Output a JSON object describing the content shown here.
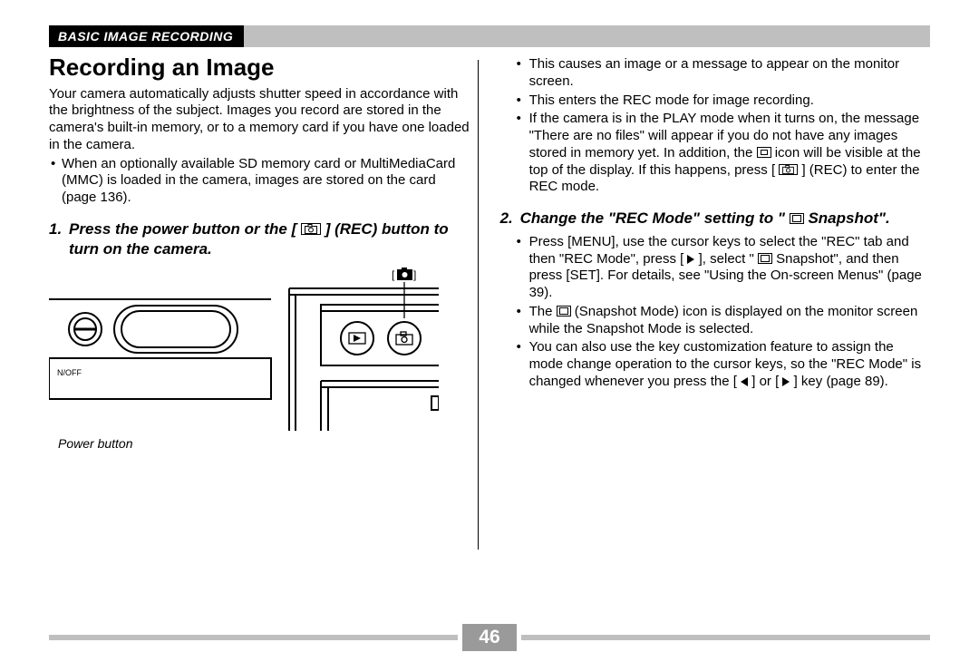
{
  "header": {
    "section": "BASIC IMAGE RECORDING"
  },
  "left": {
    "title": "Recording an Image",
    "intro": "Your camera automatically adjusts shutter speed in accordance with the brightness of the subject. Images you record are stored in the camera's built-in memory, or to a memory card if you have one loaded in the camera.",
    "bullet1": "When an optionally available SD memory card or MultiMediaCard (MMC) is loaded in the camera, images are stored on the card (page 136).",
    "step1_num": "1.",
    "step1_a": "Press the power button or the [",
    "step1_b": "] (REC) button to turn on the camera.",
    "diagram_caption": "Power button",
    "diagram_label_onoff": "N/OFF",
    "diagram_label_rec_bracket_l": "[",
    "diagram_label_rec_bracket_r": "]"
  },
  "right": {
    "b1": "This causes an image or a message to appear on the monitor screen.",
    "b2": "This enters the REC mode for image recording.",
    "b3_a": "If the camera is in the PLAY mode when it turns on, the message \"There are no files\" will appear if you do not have any images stored in memory yet. In addition, the ",
    "b3_b": " icon will be visible at the top of the display. If this happens, press [",
    "b3_c": "] (REC) to enter the REC mode.",
    "step2_num": "2.",
    "step2_a": "Change the \"REC Mode\" setting to \"",
    "step2_b": " Snapshot\".",
    "b4_a": "Press [MENU], use the cursor keys to select the \"REC\" tab and then \"REC Mode\", press [",
    "b4_b": "], select \"",
    "b4_c": " Snapshot\", and then press [SET]. For details, see \"Using the On-screen Menus\" (page 39).",
    "b5_a": "The ",
    "b5_b": " (Snapshot Mode) icon is displayed on the monitor screen while the Snapshot Mode is selected.",
    "b6_a": "You can also use the key customization feature to assign the mode change operation to the cursor keys, so the \"REC Mode\" is changed whenever you press the [",
    "b6_b": "] or [",
    "b6_c": "] key (page 89)."
  },
  "footer": {
    "page": "46"
  }
}
